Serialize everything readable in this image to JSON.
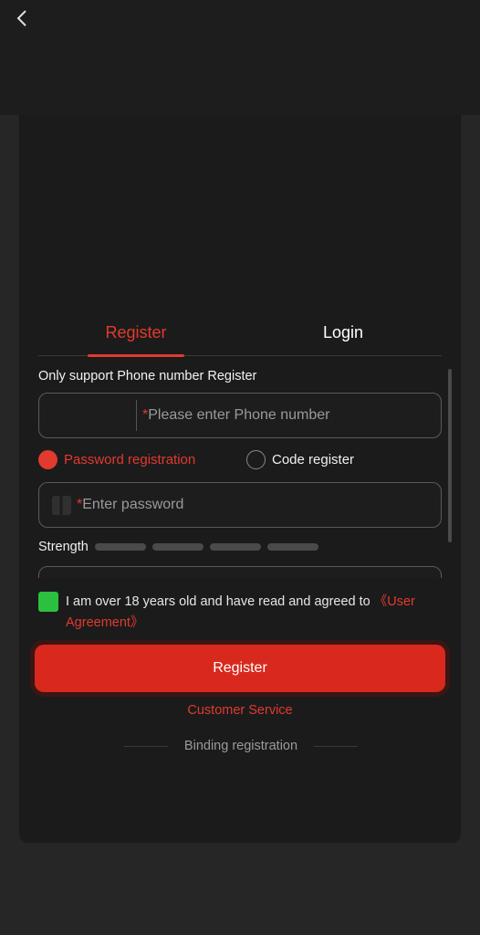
{
  "header": {
    "back_icon": "chevron-left-icon"
  },
  "tabs": {
    "register": "Register",
    "login": "Login"
  },
  "form": {
    "hint": "Only support Phone number Register",
    "phone_required_mark": "*",
    "phone_placeholder": "Please enter Phone number",
    "radio_password": "Password registration",
    "radio_code": "Code register",
    "password_required_mark": "*",
    "password_placeholder": "Enter password",
    "strength_label": "Strength",
    "strength_level": 0
  },
  "agreement": {
    "checked": true,
    "text": "I am over 18 years old and have read and agreed to ",
    "link": "《User Agreement》"
  },
  "actions": {
    "register_button": "Register",
    "customer_service": "Customer Service",
    "binding_registration": "Binding registration"
  },
  "colors": {
    "accent": "#e23a2e",
    "checkbox": "#2bc13f",
    "background": "#1b1b1b"
  }
}
